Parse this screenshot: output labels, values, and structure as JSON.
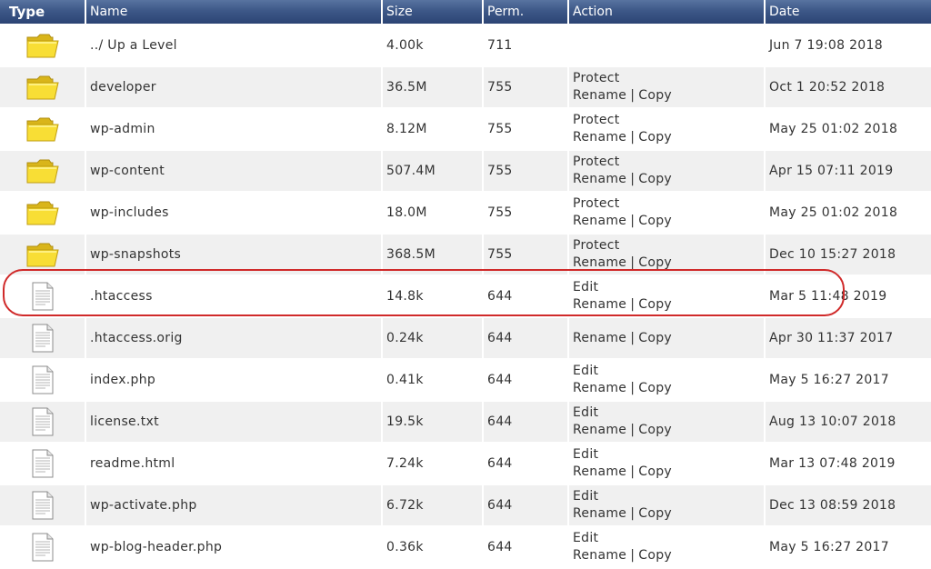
{
  "headers": {
    "type": "Type",
    "name": "Name",
    "size": "Size",
    "perm": "Perm.",
    "action": "Action",
    "date": "Date"
  },
  "action_labels": {
    "protect": "Protect",
    "edit": "Edit",
    "rename": "Rename",
    "copy": "Copy",
    "separator": "|"
  },
  "rows": [
    {
      "icon": "folder-icon",
      "name": "../ Up a Level",
      "size": "4.00k",
      "perm": "711",
      "first_action": "",
      "date": "Jun 7 19:08 2018",
      "highlighted": false
    },
    {
      "icon": "folder-icon",
      "name": "developer",
      "size": "36.5M",
      "perm": "755",
      "first_action": "Protect",
      "date": "Oct 1 20:52 2018",
      "highlighted": false
    },
    {
      "icon": "folder-icon",
      "name": "wp-admin",
      "size": "8.12M",
      "perm": "755",
      "first_action": "Protect",
      "date": "May 25 01:02 2018",
      "highlighted": false
    },
    {
      "icon": "folder-icon",
      "name": "wp-content",
      "size": "507.4M",
      "perm": "755",
      "first_action": "Protect",
      "date": "Apr 15 07:11 2019",
      "highlighted": false
    },
    {
      "icon": "folder-icon",
      "name": "wp-includes",
      "size": "18.0M",
      "perm": "755",
      "first_action": "Protect",
      "date": "May 25 01:02 2018",
      "highlighted": false
    },
    {
      "icon": "folder-icon",
      "name": "wp-snapshots",
      "size": "368.5M",
      "perm": "755",
      "first_action": "Protect",
      "date": "Dec 10 15:27 2018",
      "highlighted": false
    },
    {
      "icon": "file-icon",
      "name": ".htaccess",
      "size": "14.8k",
      "perm": "644",
      "first_action": "Edit",
      "date": "Mar 5 11:48 2019",
      "highlighted": true
    },
    {
      "icon": "file-icon",
      "name": ".htaccess.orig",
      "size": "0.24k",
      "perm": "644",
      "first_action": "",
      "date": "Apr 30 11:37 2017",
      "highlighted": false
    },
    {
      "icon": "file-icon",
      "name": "index.php",
      "size": "0.41k",
      "perm": "644",
      "first_action": "Edit",
      "date": "May 5 16:27 2017",
      "highlighted": false
    },
    {
      "icon": "file-icon",
      "name": "license.txt",
      "size": "19.5k",
      "perm": "644",
      "first_action": "Edit",
      "date": "Aug 13 10:07 2018",
      "highlighted": false
    },
    {
      "icon": "file-icon",
      "name": "readme.html",
      "size": "7.24k",
      "perm": "644",
      "first_action": "Edit",
      "date": "Mar 13 07:48 2019",
      "highlighted": false
    },
    {
      "icon": "file-icon",
      "name": "wp-activate.php",
      "size": "6.72k",
      "perm": "644",
      "first_action": "Edit",
      "date": "Dec 13 08:59 2018",
      "highlighted": false
    },
    {
      "icon": "file-icon",
      "name": "wp-blog-header.php",
      "size": "0.36k",
      "perm": "644",
      "first_action": "Edit",
      "date": "May 5 16:27 2017",
      "highlighted": false
    }
  ],
  "colors": {
    "header_bg": "#3d5888",
    "row_alt_bg": "#f0f0f0",
    "highlight_outline": "#d02a2a",
    "folder": "#f5d523"
  }
}
